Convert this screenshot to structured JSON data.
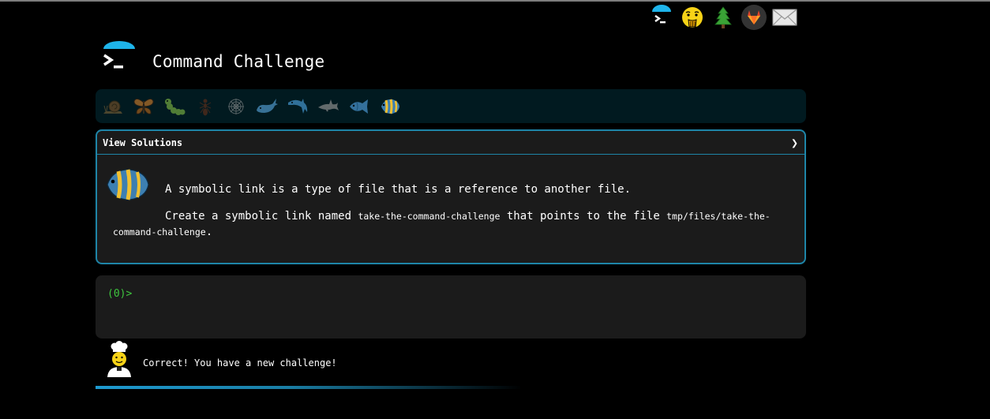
{
  "app": {
    "title": "Command Challenge"
  },
  "top_icons": [
    "terminal-icon",
    "shushing-face-icon",
    "pine-tree-icon",
    "gitlab-icon",
    "envelope-icon"
  ],
  "levels": [
    "snail-icon",
    "butterfly-icon",
    "caterpillar-icon",
    "ant-icon",
    "spider-web-icon",
    "whale-icon",
    "dolphin-icon",
    "shark-icon",
    "fish-icon",
    "angelfish-icon"
  ],
  "panel": {
    "header": "View Solutions",
    "line1": "A symbolic link is a type of file that is a reference to another file.",
    "line2_a": "Create a symbolic link named ",
    "line2_code1": "take-the-command-challenge",
    "line2_b": " that points to the file ",
    "line2_code2": "tmp/files/take-the-command-challenge",
    "line2_c": "."
  },
  "terminal": {
    "prompt": "(0)>"
  },
  "status": {
    "message": "Correct! You have a new challenge!"
  },
  "colors": {
    "accent": "#1e85a8",
    "prompt": "#3ec63e",
    "panel_bg": "#1b1b1b",
    "level_bar_bg": "#011a20"
  }
}
